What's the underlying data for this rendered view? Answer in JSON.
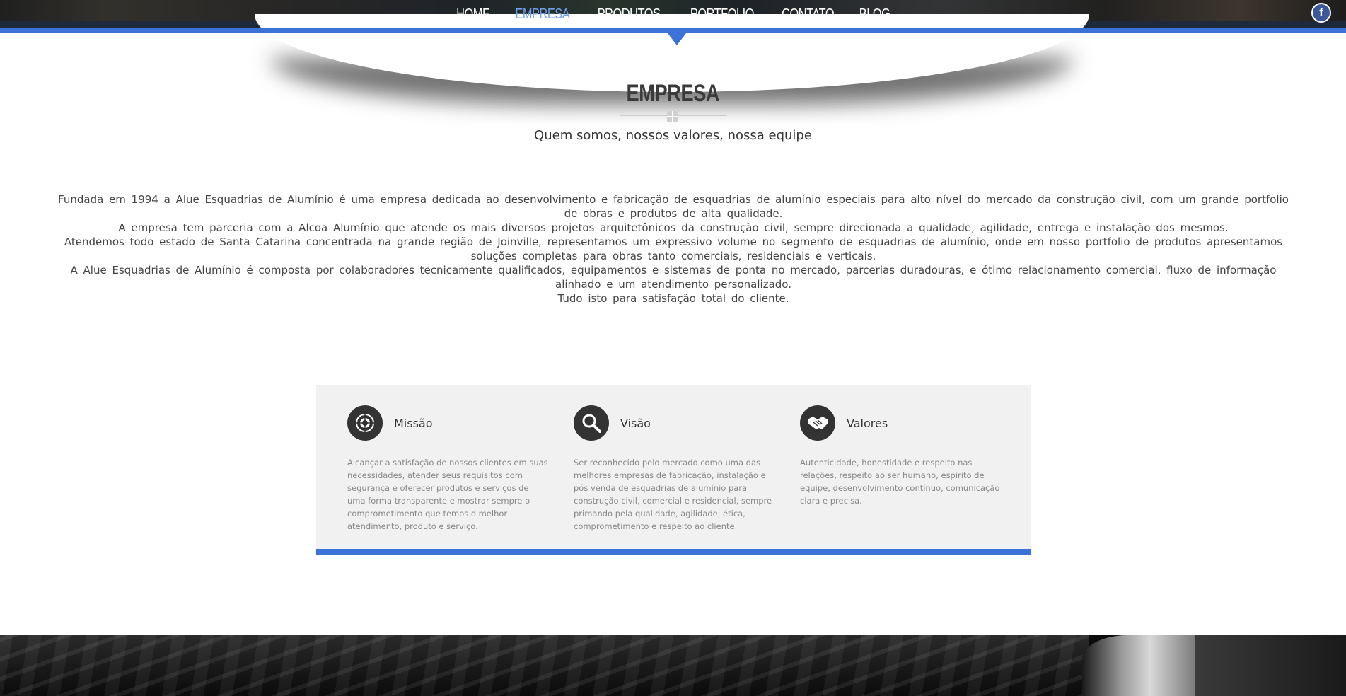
{
  "nav": {
    "items": [
      {
        "label": "HOME",
        "active": false
      },
      {
        "label": "EMPRESA",
        "active": true
      },
      {
        "label": "PRODUTOS",
        "active": false
      },
      {
        "label": "PORTFOLIO",
        "active": false
      },
      {
        "label": "CONTATO",
        "active": false
      },
      {
        "label": "BLOG",
        "active": false
      }
    ],
    "facebook_icon": "facebook-icon",
    "facebook_glyph": "f"
  },
  "section": {
    "title": "EMPRESA",
    "subtitle": "Quem somos, nossos valores, nossa equipe",
    "paragraphs": [
      "Fundada em 1994 a Alue Esquadrias de Alumínio é uma empresa dedicada ao desenvolvimento e fabricação de esquadrias de alumínio especiais para alto nível do mercado da construção civil, com um grande portfolio de obras e produtos de alta qualidade.",
      "A empresa tem parceria com a Alcoa Alumínio que atende os mais diversos projetos arquitetônicos da construção civil, sempre direcionada a qualidade, agilidade, entrega e instalação dos mesmos.",
      "Atendemos todo estado de Santa Catarina concentrada na grande região de Joinville, representamos um expressivo volume no segmento de esquadrias de alumínio, onde em nosso portfolio de produtos apresentamos soluções completas para obras tanto comerciais, residenciais e verticais.",
      "A Alue Esquadrias de Alumínio é composta por colaboradores tecnicamente qualificados, equipamentos e sistemas de ponta no mercado, parcerias duradouras, e ótimo relacionamento comercial, fluxo de informação alinhado e um atendimento personalizado.",
      "Tudo isto para satisfação total do cliente."
    ]
  },
  "features": [
    {
      "title": "Missão",
      "icon": "target-icon",
      "text": "Alcançar a satisfação de nossos clientes em suas necessidades, atender seus requisitos com segurança e oferecer produtos e serviços de uma forma transparente e mostrar sempre o comprometimento que temos o melhor atendimento, produto e serviço."
    },
    {
      "title": "Visão",
      "icon": "search-icon",
      "text": "Ser reconhecido pelo mercado como uma das melhores empresas de fabricação, instalação e pós venda de esquadrias de alumínio para construção civil, comercial e residencial, sempre primando pela qualidade, agilidade, ética, comprometimento e respeito ao cliente."
    },
    {
      "title": "Valores",
      "icon": "handshake-icon",
      "text": "Autenticidade, honestidade e respeito nas relações, respeito ao ser humano, espirito de equipe, desenvolvimento contínuo, comunicação clara e precisa."
    }
  ],
  "colors": {
    "accent": "#3a72d8",
    "nav_active": "#6f9fe8",
    "feature_bg": "#f1f1f1",
    "icon_bg": "#333333"
  }
}
